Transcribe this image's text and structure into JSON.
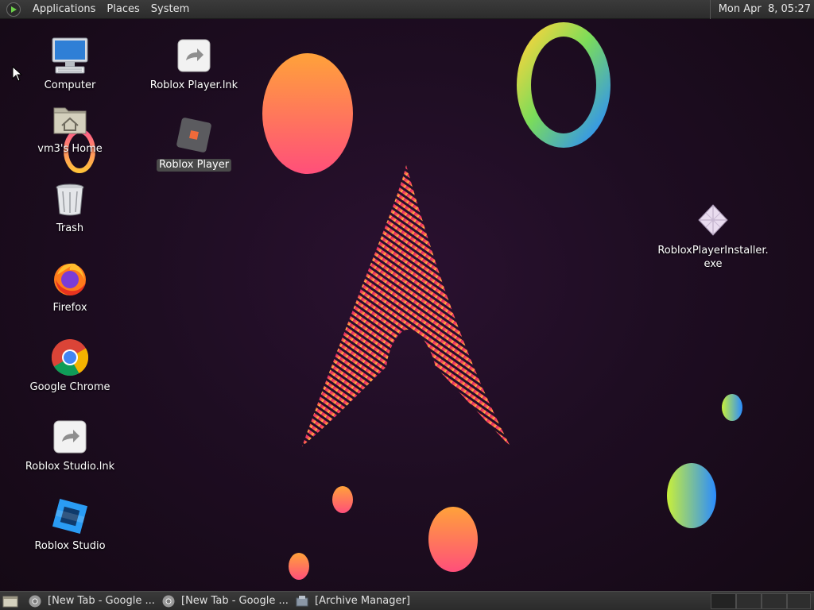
{
  "top_panel": {
    "menus": [
      "Applications",
      "Places",
      "System"
    ],
    "clock": "Mon Apr  8, 05:27"
  },
  "desktop_icons": {
    "computer": "Computer",
    "home": "vm3's Home",
    "trash": "Trash",
    "firefox": "Firefox",
    "chrome": "Google Chrome",
    "studio_lnk": "Roblox Studio.lnk",
    "studio": "Roblox Studio",
    "player_lnk": "Roblox Player.lnk",
    "player": "Roblox Player",
    "installer_line1": "RobloxPlayerInstaller.",
    "installer_line2": "exe"
  },
  "taskbar": {
    "tasks": [
      "[New Tab - Google ...",
      "[New Tab - Google ...",
      "[Archive Manager]"
    ]
  },
  "colors": {
    "panel": "#2f2f2f",
    "desktop_bg": "#1e0d22",
    "accent_pink": "#e0246e",
    "accent_orange": "#ff9a3c"
  }
}
